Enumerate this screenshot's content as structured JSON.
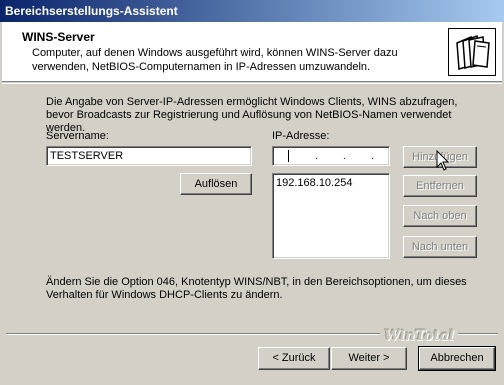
{
  "window": {
    "title": "Bereichserstellungs-Assistent"
  },
  "header": {
    "title": "WINS-Server",
    "description": "Computer, auf denen Windows ausgeführt wird, können WINS-Server dazu verwenden, NetBIOS-Computernamen in IP-Adressen umzuwandeln.",
    "icon": "folders-icon"
  },
  "intro": "Die Angabe von Server-IP-Adressen ermöglicht Windows Clients, WINS abzufragen, bevor Broadcasts zur Registrierung und Auflösung von NetBIOS-Namen verwendet werden.",
  "servername": {
    "label": "Servername:",
    "value": "TESTSERVER",
    "resolve_button": "Auflösen"
  },
  "ip": {
    "label": "IP-Adresse:",
    "dots": [
      ".",
      ".",
      "."
    ],
    "list": [
      "192.168.10.254"
    ]
  },
  "side_buttons": {
    "add": "Hinzufügen",
    "remove": "Entfernen",
    "up": "Nach oben",
    "down": "Nach unten"
  },
  "note": "Ändern Sie die Option 046, Knotentyp WINS/NBT, in den Bereichsoptionen, um dieses Verhalten für Windows DHCP-Clients zu ändern.",
  "watermark": "WinTotal",
  "footer": {
    "back": "< Zurück",
    "next": "Weiter >",
    "cancel": "Abbrechen"
  }
}
